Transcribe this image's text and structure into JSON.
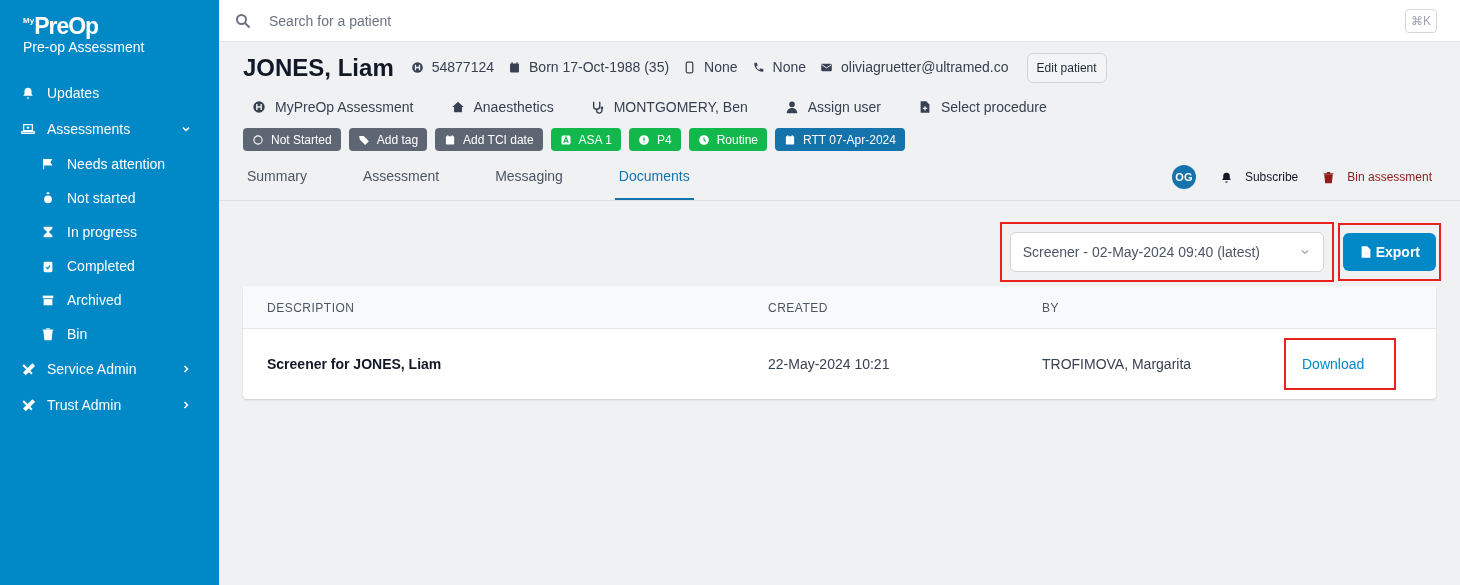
{
  "sidebar": {
    "logo_prefix": "My",
    "logo": "PreOp",
    "app_title": "Pre-op Assessment",
    "items": [
      {
        "label": "Updates"
      },
      {
        "label": "Assessments",
        "expanded": true,
        "children": [
          {
            "label": "Needs attention"
          },
          {
            "label": "Not started"
          },
          {
            "label": "In progress"
          },
          {
            "label": "Completed"
          },
          {
            "label": "Archived"
          },
          {
            "label": "Bin"
          }
        ]
      },
      {
        "label": "Service Admin",
        "expanded": false
      },
      {
        "label": "Trust Admin",
        "expanded": false
      }
    ]
  },
  "search": {
    "placeholder": "Search for a patient",
    "shortcut": "⌘K"
  },
  "patient": {
    "name": "JONES, Liam",
    "details": [
      "54877124",
      "Born 17-Oct-1988 (35)",
      "None",
      "None",
      "oliviagruetter@ultramed.co"
    ],
    "edit_button": "Edit patient",
    "meta": [
      "MyPreOp Assessment",
      "Anaesthetics",
      "MONTGOMERY, Ben",
      "Assign user",
      "Select procedure"
    ],
    "badges": [
      {
        "text": "Not Started",
        "color": "#5f6673"
      },
      {
        "text": "Add tag",
        "color": "#5f6673"
      },
      {
        "text": "Add TCI date",
        "color": "#5f6673"
      },
      {
        "text": "ASA 1",
        "color": "#12b84c"
      },
      {
        "text": "P4",
        "color": "#12b84c"
      },
      {
        "text": "Routine",
        "color": "#12b84c"
      },
      {
        "text": "RTT 07-Apr-2024",
        "color": "#1573ac"
      }
    ]
  },
  "tabs": [
    {
      "label": "Summary",
      "selected": false
    },
    {
      "label": "Assessment",
      "selected": false
    },
    {
      "label": "Messaging",
      "selected": false
    },
    {
      "label": "Documents",
      "selected": true
    }
  ],
  "actions": {
    "avatar": "OG",
    "subscribe": "Subscribe",
    "bin": "Bin assessment"
  },
  "version_select": {
    "value": "Screener - 02-May-2024 09:40 (latest)",
    "highlighted": true
  },
  "export_button": {
    "label": "Export",
    "highlighted": true
  },
  "table": {
    "columns": [
      "DESCRIPTION",
      "CREATED",
      "BY"
    ],
    "rows": [
      {
        "cells": [
          "Screener for JONES, Liam",
          "22-May-2024 10:21",
          "TROFIMOVA, Margarita"
        ],
        "action": "Download",
        "highlighted": true
      }
    ]
  }
}
